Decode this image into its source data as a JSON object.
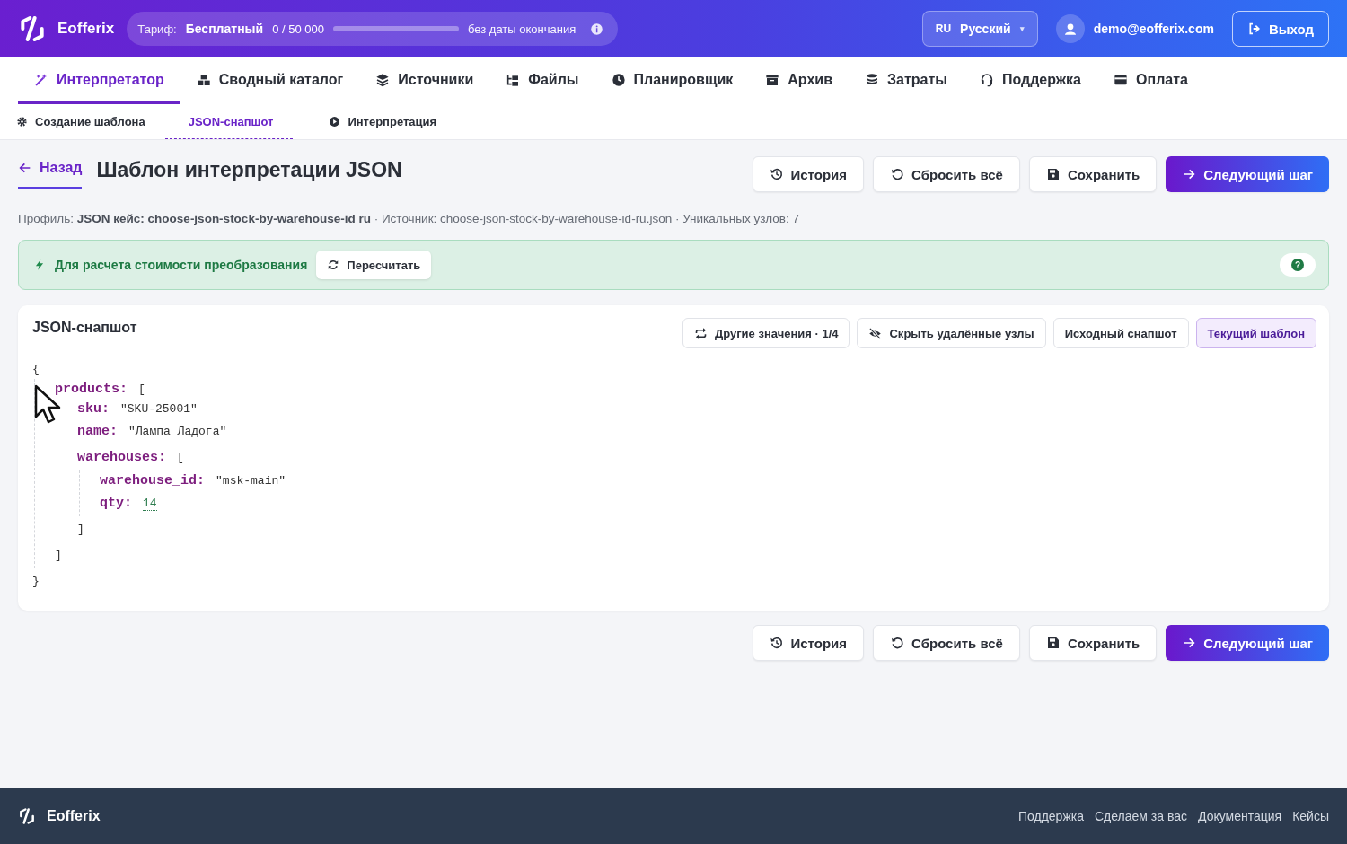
{
  "header": {
    "brand": "Eofferix",
    "plan": {
      "label": "Тариф:",
      "name": "Бесплатный",
      "usage": "0 / 50 000",
      "level": 0,
      "expiry": "без даты окончания"
    },
    "language": {
      "code": "RU",
      "name": "Русский",
      "caret": "▾"
    },
    "user": "demo@eofferix.com",
    "logout": "Выход"
  },
  "nav": [
    {
      "label": "Интерпретатор",
      "selected": true
    },
    {
      "label": "Сводный каталог",
      "selected": false
    },
    {
      "label": "Источники",
      "selected": false
    },
    {
      "label": "Файлы",
      "selected": false
    },
    {
      "label": "Планировщик",
      "selected": false
    },
    {
      "label": "Архив",
      "selected": false
    },
    {
      "label": "Затраты",
      "selected": false
    },
    {
      "label": "Поддержка",
      "selected": false
    },
    {
      "label": "Оплата",
      "selected": false
    }
  ],
  "steps": [
    {
      "label": "Создание шаблона",
      "selected": false
    },
    {
      "label": "JSON-снапшот",
      "selected": true
    },
    {
      "label": "Интерпретация",
      "selected": false
    }
  ],
  "page": {
    "back": "Назад",
    "title": "Шаблон интерпретации JSON",
    "actions": [
      "История",
      "Сбросить всё",
      "Сохранить",
      "Следующий шаг"
    ],
    "meta": "Профиль: **JSON кейс: choose-json-stock-by-warehouse-id ru** · Источник: choose-json-stock-by-warehouse-id-ru.json · Уникальных узлов: 7"
  },
  "notice": {
    "text": "Для расчета стоимости преобразования",
    "button": "Пересчитать",
    "help": "?"
  },
  "snapshot": {
    "title": "JSON-снапшот",
    "actions": [
      "Другие значения · 1/4",
      "Скрыть удалённые узлы"
    ],
    "views": [
      {
        "label": "Исходный снапшот",
        "selected": false
      },
      {
        "label": "Текущий шаблон",
        "selected": true
      }
    ],
    "tree": {
      "open": "{",
      "close": "}",
      "children": [
        {
          "key": "products:",
          "open": "[",
          "close": "]",
          "children": [
            {
              "key": "sku:",
              "kind": "string",
              "value": "\"SKU-25001\""
            },
            {
              "key": "name:",
              "kind": "string",
              "value": "\"Лампа Ладога\""
            },
            {
              "key": "warehouses:",
              "open": "[",
              "close": "]",
              "children": [
                {
                  "key": "warehouse_id:",
                  "kind": "string",
                  "value": "\"msk-main\""
                },
                {
                  "key": "qty:",
                  "kind": "number",
                  "value": "14"
                }
              ]
            }
          ]
        }
      ]
    }
  },
  "bottom_actions": [
    "История",
    "Сбросить всё",
    "Сохранить",
    "Следующий шаг"
  ],
  "footer": {
    "brand": "Eofferix",
    "links": [
      "Поддержка",
      "Сделаем за вас",
      "Документация",
      "Кейсы"
    ]
  }
}
